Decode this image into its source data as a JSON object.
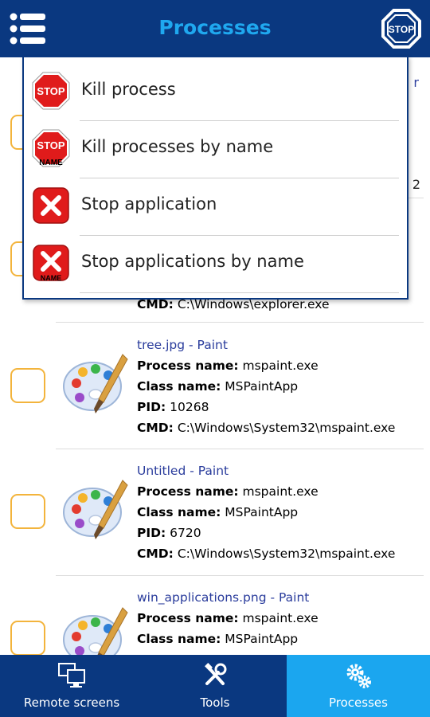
{
  "header": {
    "title": "Processes",
    "stop_label": "STOP"
  },
  "menu": {
    "items": [
      {
        "label": "Kill process",
        "icon": "stop-sign-icon"
      },
      {
        "label": "Kill processes by name",
        "icon": "stop-name-icon"
      },
      {
        "label": "Stop application",
        "icon": "close-x-icon"
      },
      {
        "label": "Stop applications by name",
        "icon": "close-x-name-icon"
      }
    ],
    "stop_text": "STOP",
    "name_text": "NAME"
  },
  "partial": {
    "row1_right": "r",
    "row1_right2": "2",
    "row2_cmd_label": "CMD:",
    "row2_cmd_value": "C:\\Windows\\explorer.exe"
  },
  "processes": [
    {
      "title": "tree.jpg - Paint",
      "process_name": "mspaint.exe",
      "class_name": "MSPaintApp",
      "pid": "10268",
      "cmd": "C:\\Windows\\System32\\mspaint.exe"
    },
    {
      "title": "Untitled - Paint",
      "process_name": "mspaint.exe",
      "class_name": "MSPaintApp",
      "pid": "6720",
      "cmd": "C:\\Windows\\System32\\mspaint.exe"
    },
    {
      "title": "win_applications.png - Paint",
      "process_name": "mspaint.exe",
      "class_name": "MSPaintApp"
    }
  ],
  "labels": {
    "process_name": "Process name:",
    "class_name": "Class name:",
    "pid": "PID:",
    "cmd": "CMD:"
  },
  "nav": {
    "tabs": [
      {
        "label": "Remote screens",
        "icon": "monitors-icon"
      },
      {
        "label": "Tools",
        "icon": "tools-icon"
      },
      {
        "label": "Processes",
        "icon": "gears-icon",
        "active": true
      }
    ]
  },
  "colors": {
    "header_bg": "#0a3880",
    "accent": "#1fa8ef",
    "checkbox_border": "#f3b43c",
    "title_text": "#2a3c9c"
  }
}
